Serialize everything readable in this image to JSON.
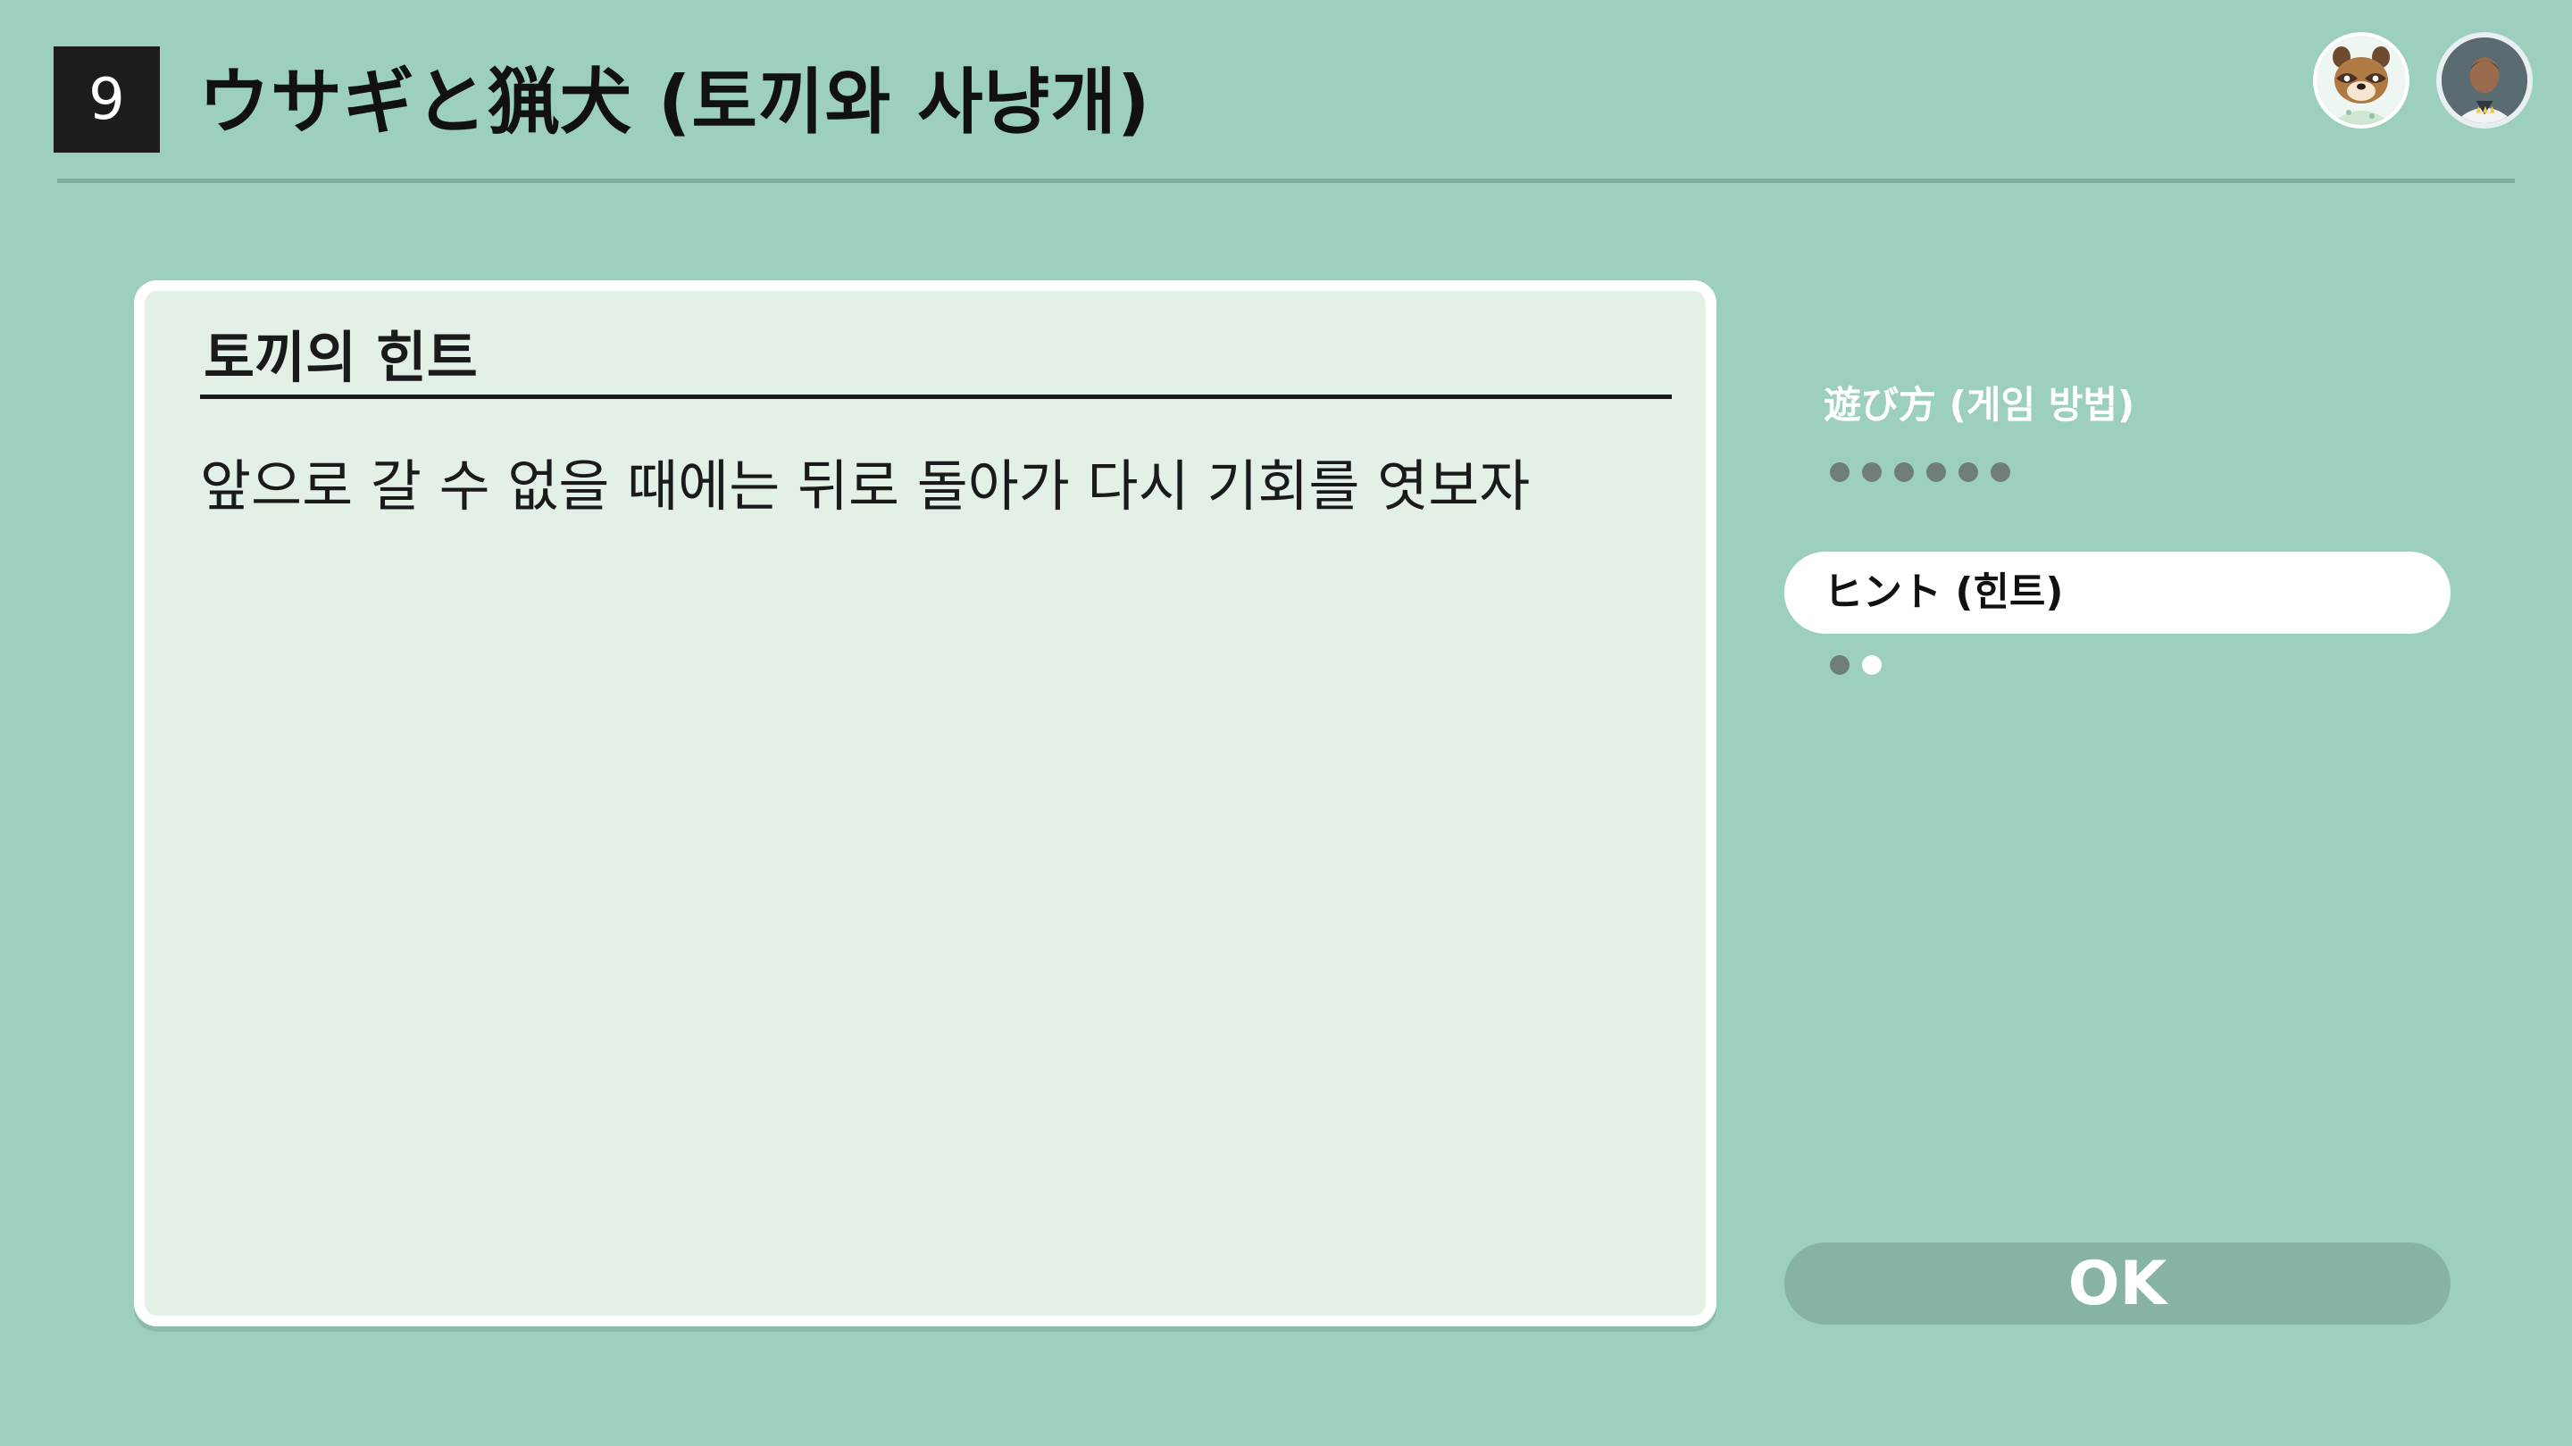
{
  "header": {
    "number": "9",
    "title": "ウサギと猟犬 (토끼와 사냥개)",
    "avatars": [
      {
        "name": "tom-nook-avatar"
      },
      {
        "name": "user-avatar"
      }
    ]
  },
  "panel": {
    "title": "토끼의 힌트",
    "body": "앞으로 갈 수 없을 때에는 뒤로 돌아가 다시 기회를 엿보자"
  },
  "sidebar": {
    "items": [
      {
        "label": "遊び方 (게임 방법)",
        "selected": false,
        "pages_total": 6,
        "current_page": 0
      },
      {
        "label": "ヒント (힌트)",
        "selected": true,
        "pages_total": 2,
        "current_page": 2
      }
    ]
  },
  "ok_button": {
    "label": "OK"
  },
  "colors": {
    "background": "#9ccfbe",
    "panel": "#e3f0e6",
    "selected_pill": "#ffffff",
    "ok_button": "#86b3a3",
    "dot_filled": "#6f7e78",
    "dot_current": "#ffffff"
  }
}
